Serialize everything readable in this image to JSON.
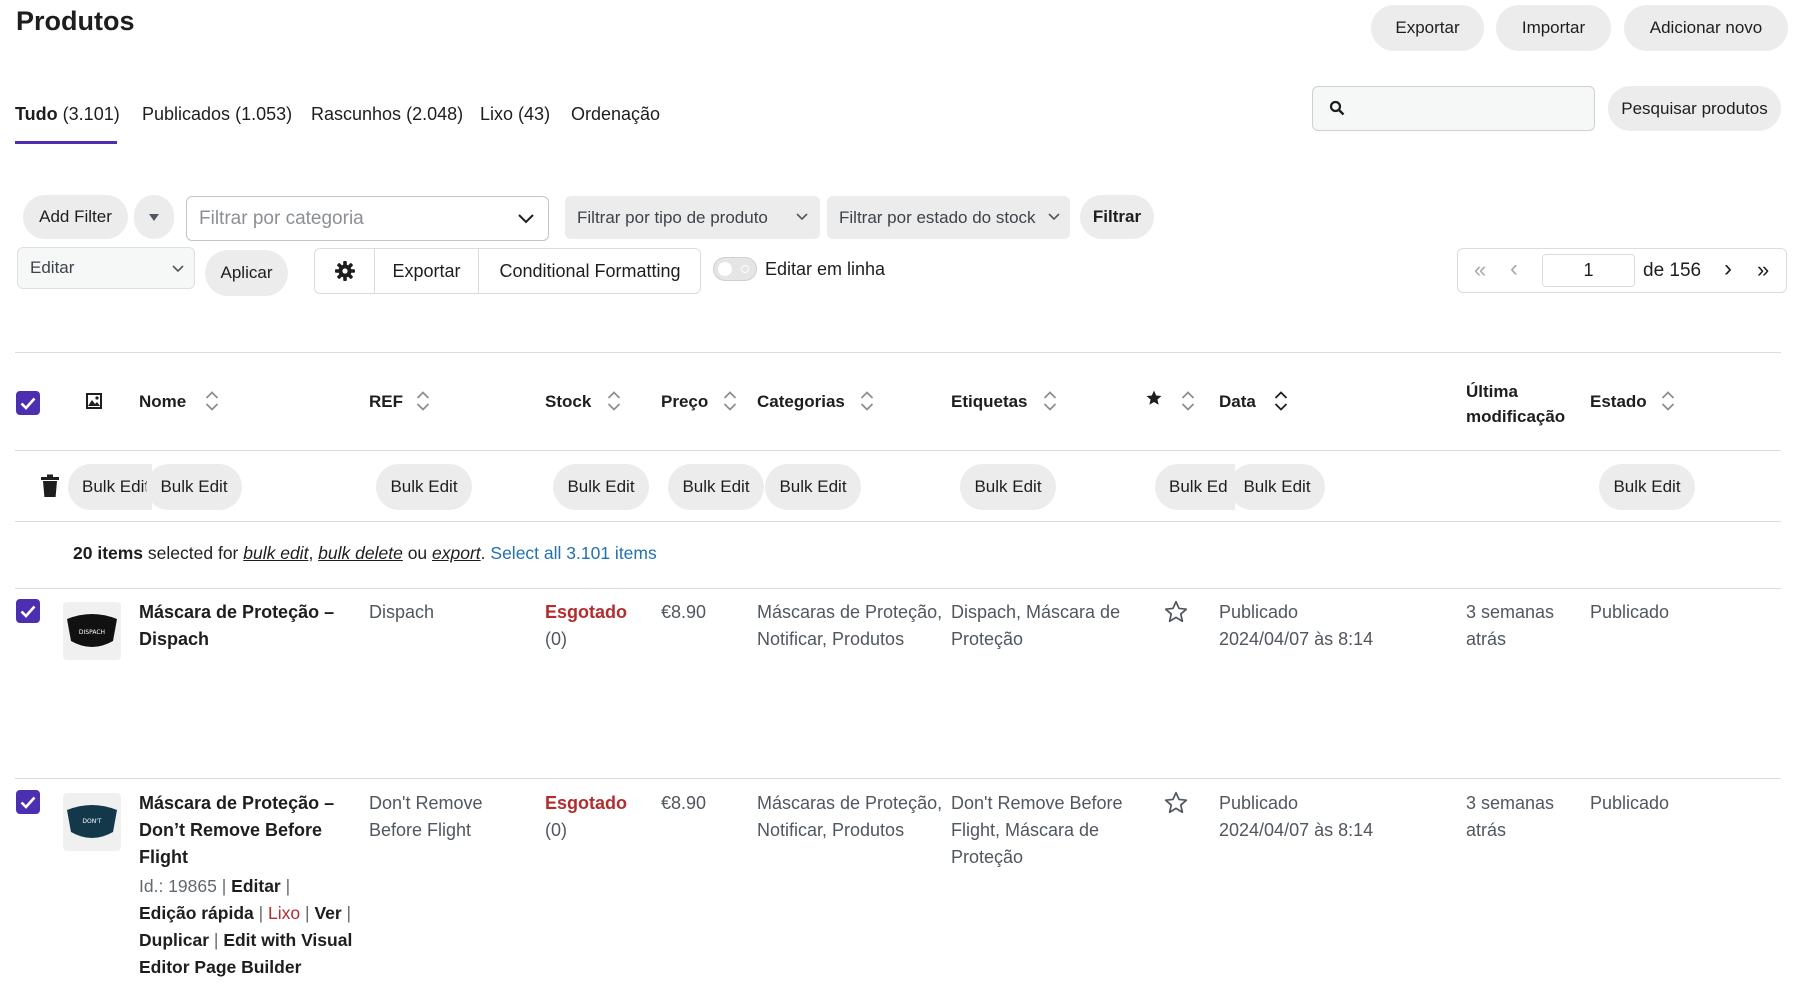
{
  "header": {
    "title": "Produtos",
    "export_label": "Exportar",
    "import_label": "Importar",
    "add_new_label": "Adicionar novo"
  },
  "status_tabs": [
    {
      "label": "Tudo",
      "count": "(3.101)"
    },
    {
      "label": "Publicados",
      "count": "(1.053)"
    },
    {
      "label": "Rascunhos",
      "count": "(2.048)"
    },
    {
      "label": "Lixo",
      "count": "(43)"
    },
    {
      "label": "Ordenação",
      "count": ""
    }
  ],
  "search": {
    "value": "",
    "button_label": "Pesquisar produtos"
  },
  "filters": {
    "add_filter_label": "Add Filter",
    "category_placeholder": "Filtrar por categoria",
    "product_type_label": "Filtrar por tipo de produto",
    "stock_status_label": "Filtrar por estado do stock",
    "filter_button_label": "Filtrar"
  },
  "bulk_actions": {
    "selected_action": "Editar",
    "apply_label": "Aplicar",
    "export_label": "Exportar",
    "conditional_formatting_label": "Conditional Formatting",
    "inline_edit_label": "Editar em linha"
  },
  "pagination": {
    "current_page": "1",
    "of_label": "de 156",
    "first": "«",
    "prev": "‹",
    "next": "›",
    "last": "»"
  },
  "table": {
    "columns": {
      "name": "Nome",
      "sku": "REF",
      "stock": "Stock",
      "price": "Preço",
      "categories": "Categorias",
      "tags": "Etiquetas",
      "date": "Data",
      "modified_line1": "Última",
      "modified_line2": "modificação",
      "status": "Estado"
    },
    "bulk_edit_label": "Bulk Edit",
    "bulk_edit_truncated_1": "Bulk Edit",
    "bulk_edit_truncated_2": "Bulk Ed",
    "selection_notice": {
      "count": "20 items",
      "text1": " selected for ",
      "bulk_edit": "bulk edit",
      "comma": ", ",
      "bulk_delete": "bulk delete",
      "or": " ou ",
      "export": "export",
      "period": ". ",
      "select_all": "Select all 3.101 items"
    },
    "rows": [
      {
        "name_l1": "Máscara de Proteção –",
        "name_l2": "Dispach",
        "name_l3": "",
        "sku_l1": "Dispach",
        "sku_l2": "",
        "stock_status": "Esgotado",
        "stock_qty": "(0)",
        "price": "€8.90",
        "cat_l1": "Máscaras de Proteção,",
        "cat_l2": "Notificar, Produtos",
        "tags_l1": "Dispach, Máscara de",
        "tags_l2": "Proteção",
        "tags_l3": "",
        "date_l1": "Publicado",
        "date_l2": "2024/04/07 às 8:14",
        "mod_l1": "3 semanas",
        "mod_l2": "atrás",
        "status": "Publicado",
        "thumb_text": "DISPACH"
      },
      {
        "name_l1": "Máscara de Proteção –",
        "name_l2": "Don’t Remove Before",
        "name_l3": "Flight",
        "sku_l1": "Don't Remove",
        "sku_l2": "Before Flight",
        "stock_status": "Esgotado",
        "stock_qty": "(0)",
        "price": "€8.90",
        "cat_l1": "Máscaras de Proteção,",
        "cat_l2": "Notificar, Produtos",
        "tags_l1": "Don't Remove Before",
        "tags_l2": "Flight, Máscara de",
        "tags_l3": "Proteção",
        "date_l1": "Publicado",
        "date_l2": "2024/04/07 às 8:14",
        "mod_l1": "3 semanas",
        "mod_l2": "atrás",
        "status": "Publicado",
        "thumb_text": "DON'T"
      }
    ],
    "row_actions": {
      "id_label": "Id.: 19865",
      "sep": " | ",
      "edit": "Editar",
      "quick_edit": "Edição rápida",
      "trash": "Lixo",
      "view": "Ver",
      "duplicate": "Duplicar",
      "visual_edit_l1": "Edit with Visual",
      "visual_edit_l2": "Editor Page Builder"
    }
  },
  "colors": {
    "accent": "#4b2fb0",
    "out_of_stock": "#b32d2e",
    "button_bg": "#ececec"
  }
}
